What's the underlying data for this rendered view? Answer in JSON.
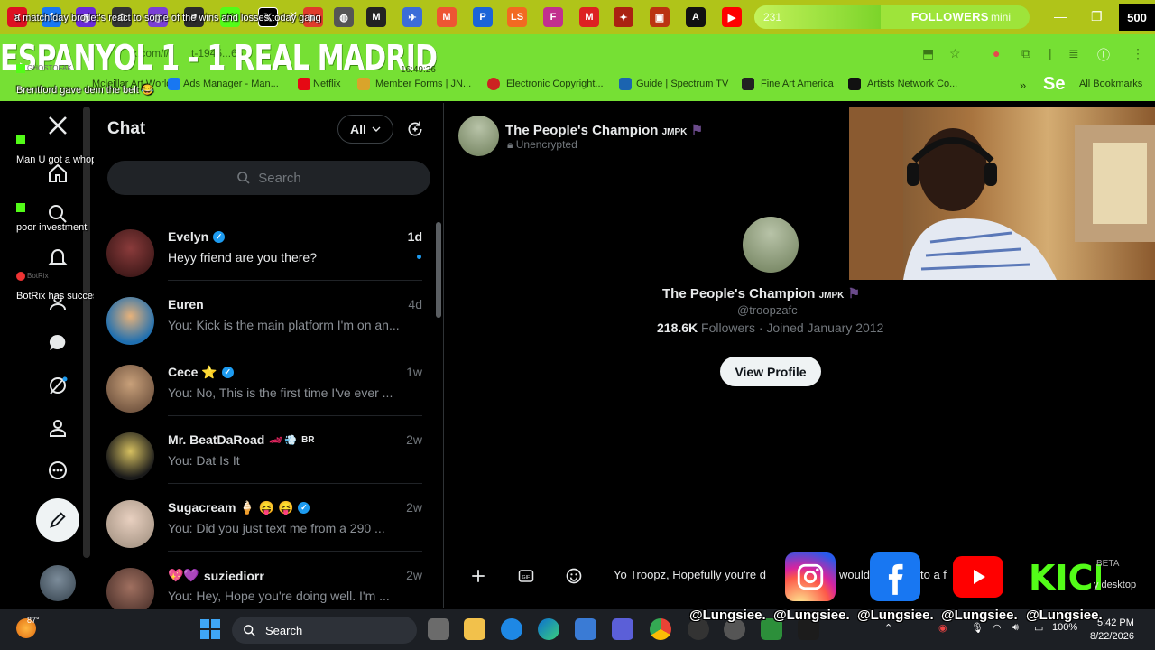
{
  "browser": {
    "tab_text": "a match day bro let's react to some of the wins and losses today gang",
    "followers_goal": {
      "count": "231",
      "label": "FOLLOWERS",
      "mini": "mini",
      "target": "500",
      "progress": 0.46
    },
    "address": {
      "url": "x.com/i/",
      "url_tail": "t-1945...66",
      "time_overlay": "16:49:26"
    },
    "stream_title": "ESPANYOL 1 - 1 REAL MADRID",
    "bookmarks": [
      {
        "label": "Mcleillar Art World",
        "color": "#c8c8c8"
      },
      {
        "label": "Ads Manager - Man...",
        "color": "#1877f2"
      },
      {
        "label": "Netflix",
        "color": "#e50914"
      },
      {
        "label": "Member Forms | JN...",
        "color": "#d9a42b"
      },
      {
        "label": "Electronic Copyright...",
        "color": "#c22"
      },
      {
        "label": "Guide | Spectrum TV",
        "color": "#1b64b0"
      },
      {
        "label": "Fine Art America",
        "color": "#222"
      },
      {
        "label": "Artists Network Co...",
        "color": "#111"
      }
    ],
    "bookmarks_overflow": "»",
    "bookmarks_se": "Se",
    "all_bookmarks": "All Bookmarks"
  },
  "stream_chat": [
    {
      "user": "GHOSTOFAK",
      "message": "Brentford gave dem the belt 😂"
    },
    {
      "user": "",
      "message": "Man U got a whoppin too 🤣"
    },
    {
      "user": "",
      "message": "poor investment"
    },
    {
      "user": "BotRix",
      "message": "BotRix has successfully joined the channel!"
    }
  ],
  "nav": {
    "items": [
      "x-logo",
      "home",
      "explore",
      "notifications",
      "communities",
      "chat",
      "grok",
      "profile",
      "more"
    ]
  },
  "chat": {
    "title": "Chat",
    "filter_label": "All",
    "search_placeholder": "Search",
    "conversations": [
      {
        "name": "Evelyn",
        "verified": true,
        "time": "1d",
        "message": "Heyy friend are you there?",
        "unread": true
      },
      {
        "name": "Euren",
        "verified": false,
        "time": "4d",
        "message": "You: Kick is the main platform I'm on an...",
        "unread": false
      },
      {
        "name": "Cece ⭐",
        "verified": true,
        "time": "1w",
        "message": "You: No, This is the first time I've ever ...",
        "unread": false
      },
      {
        "name": "Mr. BeatDaRoad",
        "suffix": "BR",
        "verified": false,
        "time": "2w",
        "message": "You: Dat Is It",
        "unread": false
      },
      {
        "name": "Sugacream 🍦 😝 😝",
        "verified": true,
        "time": "2w",
        "message": "You: Did you just text me from a 290 ...",
        "unread": false
      },
      {
        "name": "suziediorr",
        "verified": false,
        "time": "2w",
        "message": "You: Hey, Hope you're doing well. I'm ...",
        "unread": false
      }
    ]
  },
  "conversation": {
    "header_name": "The People's Champion",
    "header_badge": "JMPK",
    "encryption": "Unencrypted",
    "profile_name": "The People's Champion",
    "profile_badge": "JMPK",
    "handle": "@troopzafc",
    "followers": "218.6K",
    "followers_label": "Followers",
    "joined": "· Joined January 2012",
    "view_profile": "View Profile",
    "draft_a": "Yo Troopz, Hopefully you're d",
    "draft_b": "would",
    "draft_c": "to a f"
  },
  "overlay": {
    "handle": "@Lungsiee.",
    "beta": "BETA",
    "desktop": "y desktop",
    "colors": {
      "instagram": "#d62976",
      "facebook": "#1877f2",
      "youtube": "#ff0000",
      "kick": "#53fc18"
    }
  },
  "taskbar": {
    "weather": "87°",
    "search": "Search",
    "time": "5:42 PM",
    "date": "8/22/2026",
    "battery": "100%"
  }
}
